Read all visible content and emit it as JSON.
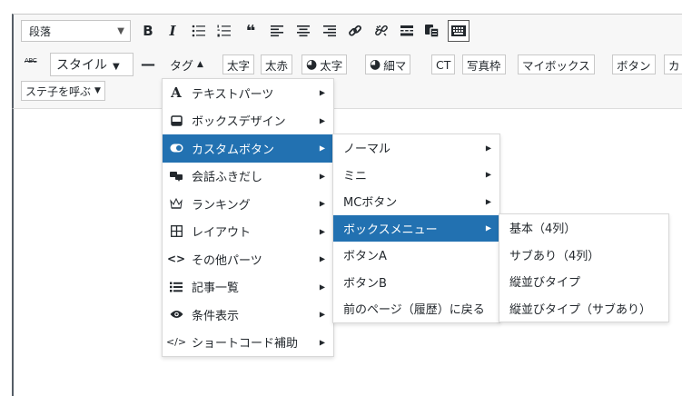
{
  "toolbar": {
    "format_select": "段落",
    "style_select": "スタイル",
    "row2_tag_label": "タグ",
    "buttons": [
      {
        "label": "太字"
      },
      {
        "label": "太赤"
      },
      {
        "label": "太字",
        "icon": "user-circle-icon"
      },
      {
        "label": "細マ",
        "icon": "user-circle-icon"
      },
      {
        "label": "CT"
      },
      {
        "label": "写真枠"
      },
      {
        "label": "マイボックス"
      },
      {
        "label": "ボタン"
      },
      {
        "label": "カ"
      }
    ],
    "shortcode_select": "ステ子を呼ぶ"
  },
  "menu_main": [
    {
      "label": "テキストパーツ",
      "icon": "text-a-icon"
    },
    {
      "label": "ボックスデザイン",
      "icon": "box-icon"
    },
    {
      "label": "カスタムボタン",
      "icon": "toggle-icon",
      "active": true
    },
    {
      "label": "会話ふきだし",
      "icon": "speech-bubble-icon"
    },
    {
      "label": "ランキング",
      "icon": "crown-icon"
    },
    {
      "label": "レイアウト",
      "icon": "grid-icon"
    },
    {
      "label": "その他パーツ",
      "icon": "code-angle-icon"
    },
    {
      "label": "記事一覧",
      "icon": "list-icon"
    },
    {
      "label": "条件表示",
      "icon": "eye-icon"
    },
    {
      "label": "ショートコード補助",
      "icon": "code-slash-icon"
    }
  ],
  "menu_buttons": [
    {
      "label": "ノーマル",
      "submenu": true
    },
    {
      "label": "ミニ",
      "submenu": true
    },
    {
      "label": "MCボタン",
      "submenu": true
    },
    {
      "label": "ボックスメニュー",
      "submenu": true,
      "active": true
    },
    {
      "label": "ボタンA",
      "submenu": false
    },
    {
      "label": "ボタンB",
      "submenu": false
    },
    {
      "label": "前のページ（履歴）に戻る",
      "submenu": false
    }
  ],
  "menu_boxmenu": [
    {
      "label": "基本（4列）"
    },
    {
      "label": "サブあり（4列）"
    },
    {
      "label": "縦並びタイプ"
    },
    {
      "label": "縦並びタイプ（サブあり）"
    }
  ],
  "colors": {
    "accent": "#2271b1",
    "toolbar_bg": "#f7f7f7",
    "border": "#c8c8c8"
  }
}
